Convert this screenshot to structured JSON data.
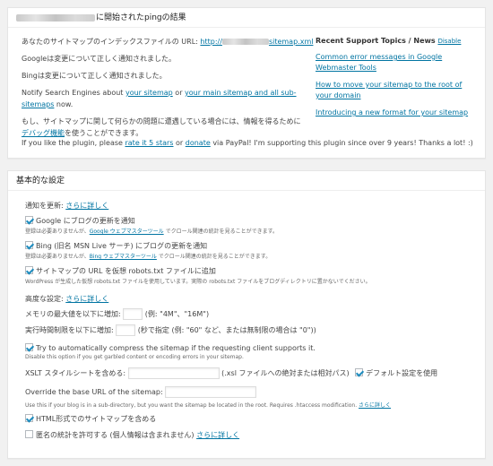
{
  "result_box": {
    "title": "に開始されたpingの結果",
    "sitemap_line_prefix": "あなたのサイトマップのインデックスファイルの URL: ",
    "sitemap_url_prefix": "http://",
    "sitemap_url_suffix": "sitemap.xml",
    "google_line": "Googleは変更について正しく通知されました。",
    "bing_line": "Bingは変更について正しく通知されました。",
    "notify_prefix": "Notify Search Engines about ",
    "notify_link1": "your sitemap",
    "notify_or": " or ",
    "notify_link2": "your main sitemap and all sub-sitemaps",
    "notify_suffix": " now.",
    "problem_prefix": "もし、サイトマップに関して何らかの問題に遭遇している場合には、情報を得るために",
    "problem_link": "デバッグ機能",
    "problem_suffix": "を使うことができます。",
    "support_head": "Recent Support Topics / News",
    "support_disable": "Disable",
    "topics": [
      "Common error messages in Google Webmaster Tools",
      "How to move your sitemap to the root of your domain",
      "Introducing a new format for your sitemap"
    ],
    "plugin_prefix": "If you like the plugin, please ",
    "plugin_rate": "rate it 5 stars",
    "plugin_or": " or ",
    "plugin_donate": "donate",
    "plugin_suffix": " via PayPal! I'm supporting this plugin since over 9 years! Thanks a lot! :)"
  },
  "settings": {
    "title": "基本的な設定",
    "notify_label": "通知を更新: ",
    "more_link": "さらに詳しく",
    "google_cb": "Google にブログの更新を通知",
    "google_desc_prefix": "登録は必要ありませんが、",
    "google_desc_link": "Google ウェブマスターツール",
    "google_desc_suffix": " でクロール関連の統計を見ることができます。",
    "bing_cb": "Bing (旧名 MSN Live サーチ) にブログの更新を通知",
    "bing_desc_prefix": "登録は必要ありませんが、",
    "bing_desc_link": "Bing ウェブマスターツール",
    "bing_desc_suffix": " でクロール関連の統計を見ることができます。",
    "robots_cb": "サイトマップの URL を仮想 robots.txt ファイルに追加",
    "robots_desc": "WordPress が生成した仮想 robots.txt ファイルを使用しています。実際の robots.txt ファイルをブログディレクトリに置かないでください。",
    "advanced_label": "高度な設定: ",
    "memory_label": "メモリの最大値を以下に増加: ",
    "memory_hint": " (例: \"4M\"、\"16M\")",
    "time_label": "実行時間制限を以下に増加: ",
    "time_hint": " (秒で指定 (例: \"60\" など、または無制限の場合は \"0\"))",
    "compress_cb": "Try to automatically compress the sitemap if the requesting client supports it.",
    "compress_desc": "Disable this option if you get garbled content or encoding errors in your sitemap.",
    "xslt_label": "XSLT スタイルシートを含める: ",
    "xslt_hint": " (.xsl ファイルへの絶対または相対パス)",
    "xslt_default_cb": "デフォルト設定を使用",
    "override_label": "Override the base URL of the sitemap: ",
    "override_desc_prefix": "Use this if your blog is in a sub-directory, but you want the sitemap be located in the root. Requires .htaccess modification. ",
    "html_cb": "HTML形式でのサイトマップを含める",
    "anon_cb": "匿名の統計を許可する (個人情報は含まれません) "
  }
}
